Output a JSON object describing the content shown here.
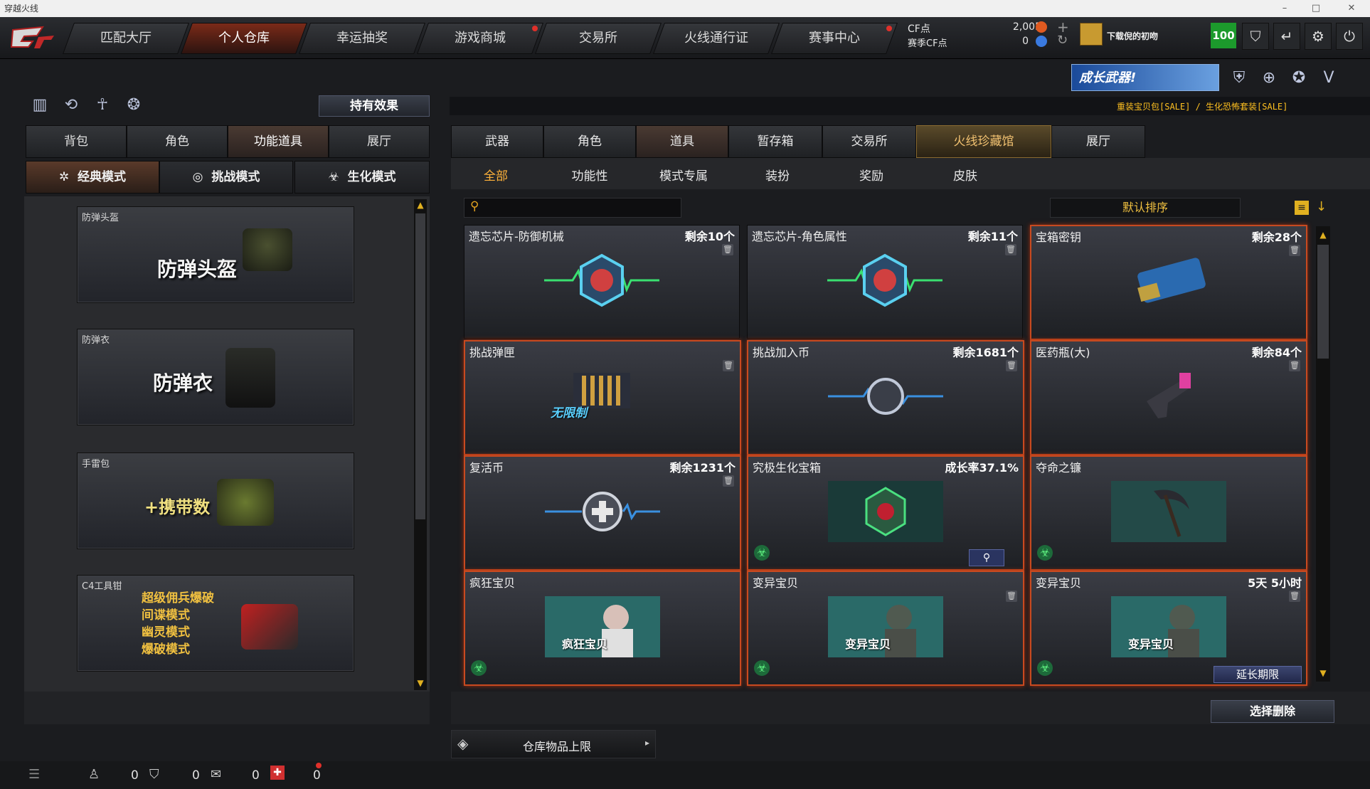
{
  "window": {
    "title": "穿越火线",
    "min": "–",
    "max": "□",
    "close": "✕"
  },
  "nav": {
    "tabs": [
      {
        "label": "匹配大厅",
        "active": false
      },
      {
        "label": "个人仓库",
        "active": true
      },
      {
        "label": "幸运抽奖",
        "active": false
      },
      {
        "label": "游戏商城",
        "active": false
      },
      {
        "label": "交易所",
        "active": false
      },
      {
        "label": "火线通行证",
        "active": false
      },
      {
        "label": "赛事中心",
        "active": false
      }
    ],
    "cf_label": "CF点",
    "cf_value": "2,005",
    "event_cf_label": "赛季CF点",
    "event_cf_value": "0",
    "plus": "+",
    "refresh": "↻",
    "username": "下载倪的初吻",
    "level": "100",
    "icons": [
      "shield-icon",
      "exit-icon",
      "gear-icon",
      "power-icon"
    ]
  },
  "banner": {
    "growth_weapon": "成长武器!",
    "sale_text": "重装宝贝包[SALE] / 生化恐怖套装[SALE]"
  },
  "left": {
    "effect_button": "持有效果",
    "tabs": [
      {
        "label": "背包",
        "active": false
      },
      {
        "label": "角色",
        "active": false
      },
      {
        "label": "功能道具",
        "active": true
      },
      {
        "label": "展厅",
        "active": false
      }
    ],
    "modes": [
      {
        "label": "经典模式",
        "active": true,
        "icon": "✲"
      },
      {
        "label": "挑战模式",
        "active": false,
        "icon": "◎"
      },
      {
        "label": "生化模式",
        "active": false,
        "icon": "☣"
      }
    ],
    "slots": [
      {
        "label": "防弹头盔",
        "big": "防弹头盔"
      },
      {
        "label": "防弹衣",
        "big": "防弹衣"
      },
      {
        "label": "手雷包",
        "big": "+携带数"
      },
      {
        "label": "C4工具钳",
        "lines": [
          "超级佣兵爆破",
          "间谍模式",
          "幽灵模式",
          "爆破模式"
        ]
      }
    ]
  },
  "right": {
    "tabs": [
      {
        "label": "武器",
        "active": false
      },
      {
        "label": "角色",
        "active": false
      },
      {
        "label": "道具",
        "active": true
      },
      {
        "label": "暂存箱",
        "active": false
      },
      {
        "label": "交易所",
        "active": false
      },
      {
        "label": "火线珍藏馆",
        "active": false
      },
      {
        "label": "展厅",
        "active": false
      }
    ],
    "subtabs": [
      {
        "label": "全部",
        "active": true
      },
      {
        "label": "功能性",
        "active": false
      },
      {
        "label": "模式专属",
        "active": false
      },
      {
        "label": "装扮",
        "active": false
      },
      {
        "label": "奖励",
        "active": false
      },
      {
        "label": "皮肤",
        "active": false
      }
    ],
    "sort_label": "默认排序",
    "items": [
      {
        "name": "遗忘芯片-防御机械",
        "count": "剩余10个",
        "hl": false
      },
      {
        "name": "遗忘芯片-角色属性",
        "count": "剩余11个",
        "hl": false
      },
      {
        "name": "宝箱密钥",
        "count": "剩余28个",
        "hl": true
      },
      {
        "name": "挑战弹匣",
        "count": "",
        "hl": true,
        "tag": "无限制"
      },
      {
        "name": "挑战加入币",
        "count": "剩余1681个",
        "hl": true
      },
      {
        "name": "医药瓶(大)",
        "count": "剩余84个",
        "hl": true
      },
      {
        "name": "复活币",
        "count": "剩余1231个",
        "hl": true
      },
      {
        "name": "究极生化宝箱",
        "count": "成长率37.1%",
        "hl": true
      },
      {
        "name": "夺命之镰",
        "count": "",
        "hl": true
      },
      {
        "name": "疯狂宝贝",
        "count": "",
        "hl": true,
        "tag": "疯狂宝贝"
      },
      {
        "name": "变异宝贝",
        "count": "",
        "hl": true,
        "tag": "变异宝贝"
      },
      {
        "name": "变异宝贝",
        "count": "5天 5小时",
        "hl": true,
        "tag": "变异宝贝"
      }
    ],
    "extend_button": "延长期限",
    "delete_button": "选择删除",
    "storage_limit": "仓库物品上限"
  },
  "bottom": {
    "counts": [
      "0",
      "0",
      "0",
      "0"
    ]
  }
}
